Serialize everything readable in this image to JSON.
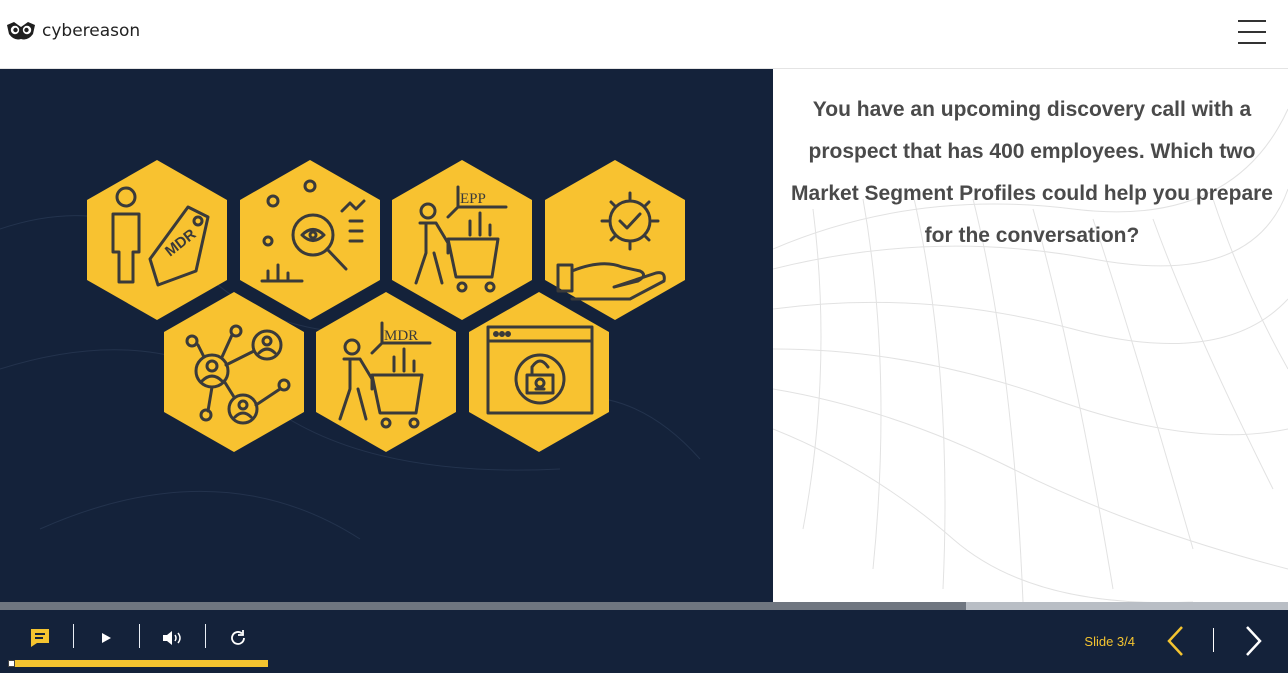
{
  "brand": {
    "name": "cybereason"
  },
  "question": {
    "text": "You have an upcoming discovery call with a prospect that has 400 employees. Which two Market Segment Profiles could help you prepare for the conversation?"
  },
  "hexagons": [
    {
      "icon": "person-mdr-tag-icon",
      "label": "MDR"
    },
    {
      "icon": "magnifier-analytics-icon",
      "label": ""
    },
    {
      "icon": "person-cart-epp-icon",
      "label": "EPP"
    },
    {
      "icon": "hand-gear-check-icon",
      "label": ""
    },
    {
      "icon": "people-network-icon",
      "label": ""
    },
    {
      "icon": "person-cart-mdr-icon",
      "label": "MDR"
    },
    {
      "icon": "browser-lock-skull-icon",
      "label": ""
    }
  ],
  "player": {
    "slide_label": "Slide 3/4",
    "progress": 0.75,
    "timeline_progress": 1.0,
    "controls": [
      "notes-icon",
      "play-icon",
      "volume-icon",
      "replay-icon"
    ]
  },
  "colors": {
    "accent": "#f4c430",
    "dark_bg": "#14223a",
    "hex_fill": "#f8c230",
    "icon_stroke": "#3a3a3a"
  }
}
